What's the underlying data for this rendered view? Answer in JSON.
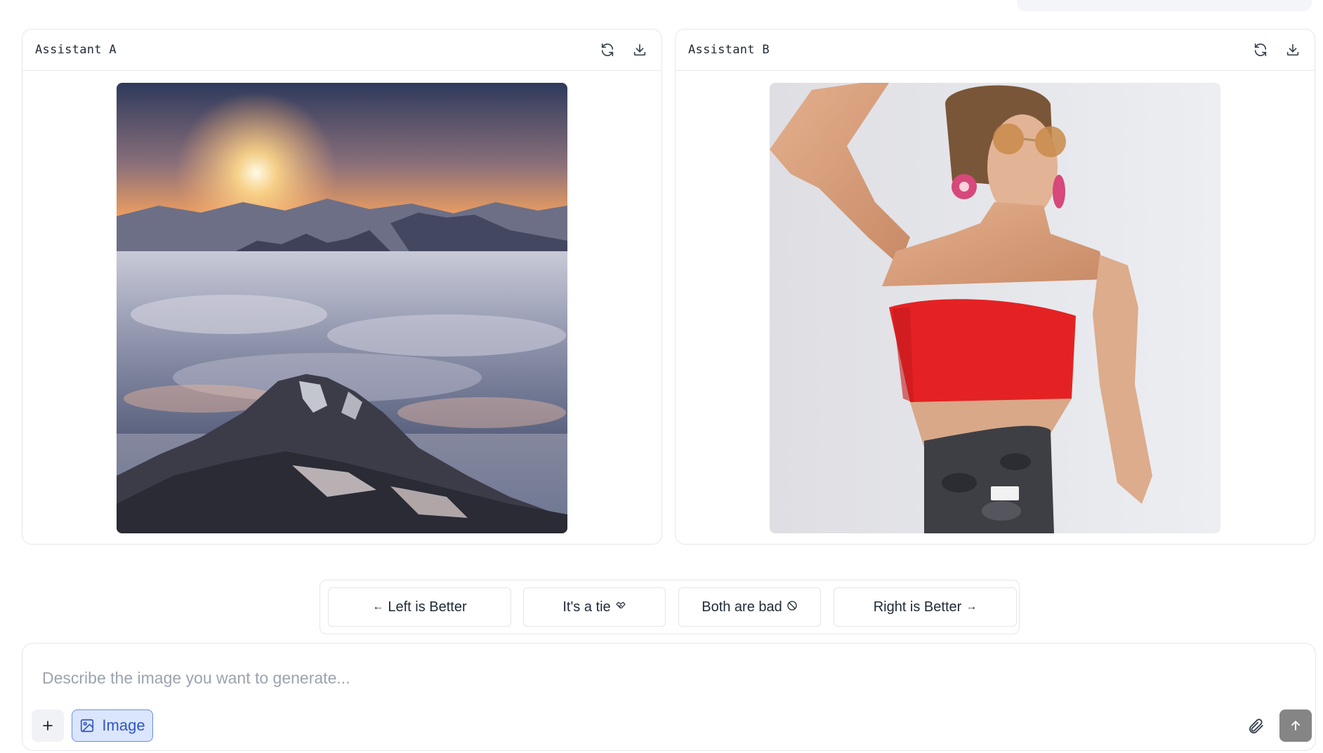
{
  "assistant_a": {
    "title": "Assistant A",
    "image_description_icon": "mountain-sunrise-image",
    "actions": [
      "refresh-icon",
      "download-icon"
    ]
  },
  "assistant_b": {
    "title": "Assistant B",
    "image_description_icon": "fashion-portrait-image",
    "actions": [
      "refresh-icon",
      "download-icon"
    ]
  },
  "vote": {
    "left_label": "Left is Better",
    "left_glyph": "←",
    "tie_label": "It's a tie",
    "tie_glyph": "🤝",
    "bad_label": "Both are bad",
    "bad_glyph": "⃠",
    "right_label": "Right is Better",
    "right_glyph": "→"
  },
  "composer": {
    "placeholder": "Describe the image you want to generate...",
    "value": "",
    "plus_label": "+",
    "mode_label": "Image"
  },
  "colors": {
    "accent": "#2f55c9",
    "accent_bg": "#dbe6fd",
    "border": "#e5e7eb",
    "send_bg": "#858585"
  }
}
